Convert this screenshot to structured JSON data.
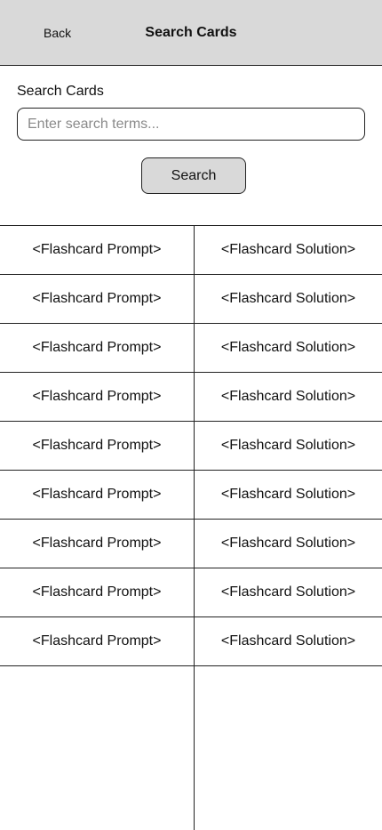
{
  "header": {
    "back_label": "Back",
    "title": "Search Cards"
  },
  "search": {
    "label": "Search Cards",
    "placeholder": "Enter search terms...",
    "value": "",
    "button_label": "Search"
  },
  "results": [
    {
      "prompt": "<Flashcard Prompt>",
      "solution": "<Flashcard Solution>"
    },
    {
      "prompt": "<Flashcard Prompt>",
      "solution": "<Flashcard Solution>"
    },
    {
      "prompt": "<Flashcard Prompt>",
      "solution": "<Flashcard Solution>"
    },
    {
      "prompt": "<Flashcard Prompt>",
      "solution": "<Flashcard Solution>"
    },
    {
      "prompt": "<Flashcard Prompt>",
      "solution": "<Flashcard Solution>"
    },
    {
      "prompt": "<Flashcard Prompt>",
      "solution": "<Flashcard Solution>"
    },
    {
      "prompt": "<Flashcard Prompt>",
      "solution": "<Flashcard Solution>"
    },
    {
      "prompt": "<Flashcard Prompt>",
      "solution": "<Flashcard Solution>"
    },
    {
      "prompt": "<Flashcard Prompt>",
      "solution": "<Flashcard Solution>"
    }
  ]
}
